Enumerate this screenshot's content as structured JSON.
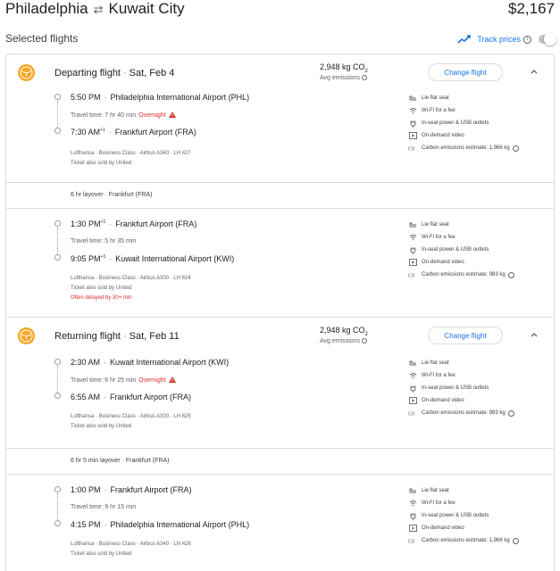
{
  "header": {
    "origin": "Philadelphia",
    "destination": "Kuwait City",
    "price": "$2,167"
  },
  "selected_label": "Selected flights",
  "track": {
    "label": "Track prices"
  },
  "departing": {
    "title": "Departing flight",
    "date": "Sat, Feb 4",
    "emissions": "2,948 kg CO",
    "emissions_sub": "2",
    "emissions_note": "Avg emissions",
    "change_label": "Change flight",
    "legs": [
      {
        "dep_time": "5:50 PM",
        "dep_sup": "",
        "dep_airport": "Philadelphia International Airport (PHL)",
        "travel_time": "Travel time: 7 hr 40 min",
        "overnight": "Overnight",
        "arr_time": "7:30 AM",
        "arr_sup": "+1",
        "arr_airport": "Frankfurt Airport (FRA)",
        "details": "Lufthansa · Business Class · Airbus A340 · LH 427",
        "sold_by": "Ticket also sold by United",
        "delay": "",
        "amenities": [
          "Lie flat seat",
          "Wi-Fi for a fee",
          "In-seat power & USB outlets",
          "On-demand video",
          "Carbon emissions estimate: 1,966 kg"
        ]
      },
      {
        "dep_time": "1:30 PM",
        "dep_sup": "+1",
        "dep_airport": "Frankfurt Airport (FRA)",
        "travel_time": "Travel time: 5 hr 35 min",
        "overnight": "",
        "arr_time": "9:05 PM",
        "arr_sup": "+1",
        "arr_airport": "Kuwait International Airport (KWI)",
        "details": "Lufthansa · Business Class · Airbus A330 · LH 624",
        "sold_by": "Ticket also sold by United",
        "delay": "Often delayed by 30+ min",
        "amenities": [
          "Lie flat seat",
          "Wi-Fi for a fee",
          "In-seat power & USB outlets",
          "On-demand video",
          "Carbon emissions estimate: 983 kg"
        ]
      }
    ],
    "layover": "6 hr layover · Frankfurt (FRA)"
  },
  "returning": {
    "title": "Returning flight",
    "date": "Sat, Feb 11",
    "emissions": "2,948 kg CO",
    "emissions_sub": "2",
    "emissions_note": "Avg emissions",
    "change_label": "Change flight",
    "legs": [
      {
        "dep_time": "2:30 AM",
        "dep_sup": "",
        "dep_airport": "Kuwait International Airport (KWI)",
        "travel_time": "Travel time: 6 hr 25 min",
        "overnight": "Overnight",
        "arr_time": "6:55 AM",
        "arr_sup": "",
        "arr_airport": "Frankfurt Airport (FRA)",
        "details": "Lufthansa · Business Class · Airbus A330 · LH 625",
        "sold_by": "Ticket also sold by United",
        "delay": "",
        "amenities": [
          "Lie flat seat",
          "Wi-Fi for a fee",
          "In-seat power & USB outlets",
          "On-demand video",
          "Carbon emissions estimate: 983 kg"
        ]
      },
      {
        "dep_time": "1:00 PM",
        "dep_sup": "",
        "dep_airport": "Frankfurt Airport (FRA)",
        "travel_time": "Travel time: 9 hr 15 min",
        "overnight": "",
        "arr_time": "4:15 PM",
        "arr_sup": "",
        "arr_airport": "Philadelphia International Airport (PHL)",
        "details": "Lufthansa · Business Class · Airbus A340 · LH 426",
        "sold_by": "Ticket also sold by United",
        "delay": "",
        "amenities": [
          "Lie flat seat",
          "Wi-Fi for a fee",
          "In-seat power & USB outlets",
          "On-demand video",
          "Carbon emissions estimate: 1,966 kg"
        ]
      }
    ],
    "layover": "6 hr 5 min layover · Frankfurt (FRA)"
  },
  "icons": {
    "amenities": [
      "seat-icon",
      "wifi-icon",
      "power-icon",
      "video-icon",
      "co2-icon"
    ],
    "logo": "lufthansa-logo-icon",
    "track": "trend-icon"
  },
  "colors": {
    "accent": "#1a73e8",
    "warning": "#d93025",
    "logo": "#f5a623"
  }
}
